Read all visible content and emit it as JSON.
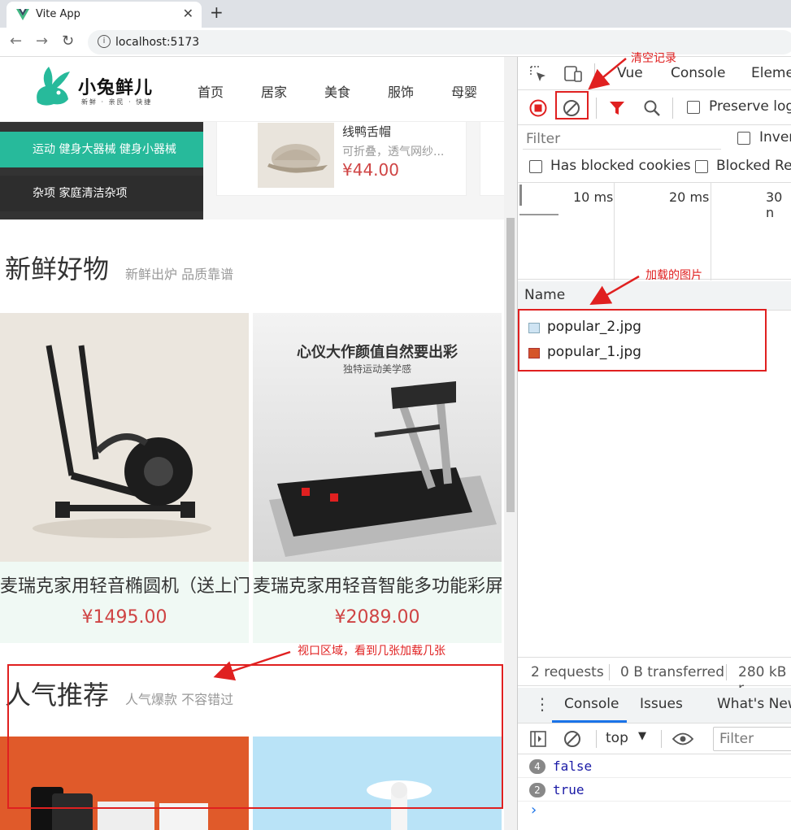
{
  "browser": {
    "tab_title": "Vite App",
    "url": "localhost:5173"
  },
  "page": {
    "logo_text": "小兔鲜儿",
    "logo_sub": "新鲜 · 亲民 · 快捷",
    "nav": [
      "首页",
      "居家",
      "美食",
      "服饰",
      "母婴"
    ],
    "category_menu": [
      {
        "label": "运动 健身大器械 健身小器械",
        "active": true
      },
      {
        "label": "杂项 家庭清洁杂项",
        "active": false
      }
    ],
    "popular_card": {
      "name": "线鸭舌帽",
      "desc": "可折叠，透气网纱...",
      "price": "¥44.00"
    },
    "sections": {
      "fresh": {
        "title": "新鲜好物",
        "subtitle": "新鲜出炉 品质靠谱"
      },
      "popular": {
        "title": "人气推荐",
        "subtitle": "人气爆款 不容错过"
      }
    },
    "goods": [
      {
        "name": "麦瑞克家用轻音椭圆机（送上门安装）",
        "price": "¥1495.00",
        "image_kind": "elliptical-machine"
      },
      {
        "name": "麦瑞克家用轻音智能多功能彩屏跑步机",
        "price": "¥2089.00",
        "image_kind": "treadmill",
        "image_headline": "心仪大作颜值自然要出彩",
        "image_subline": "独特运动美学感"
      }
    ]
  },
  "devtools": {
    "tabs": [
      "Vue",
      "Console",
      "Elemen"
    ],
    "preserve_log": "Preserve log",
    "filter_placeholder": "Filter",
    "invert": "Inver",
    "has_blocked_cookies": "Has blocked cookies",
    "blocked_requests": "Blocked Rec",
    "timeline_labels": [
      "10 ms",
      "20 ms",
      "30 n"
    ],
    "name_header": "Name",
    "requests": [
      "popular_2.jpg",
      "popular_1.jpg"
    ],
    "status": {
      "requests": "2 requests",
      "transferred": "0 B transferred",
      "resources": "280 kB r"
    },
    "drawer_tabs": [
      "Console",
      "Issues",
      "What's New"
    ],
    "console_context": "top",
    "console_filter": "Filter",
    "console_lines": [
      {
        "count": "4",
        "value": "false"
      },
      {
        "count": "2",
        "value": "true"
      }
    ],
    "prompt": "›"
  },
  "annotations": {
    "clear_log": "清空记录",
    "loaded_images": "加载的图片",
    "viewport_note": "视口区域，看到几张加载几张"
  },
  "colors": {
    "brand": "#27ba9b",
    "price": "#cf4444",
    "annotation": "#e02020"
  }
}
